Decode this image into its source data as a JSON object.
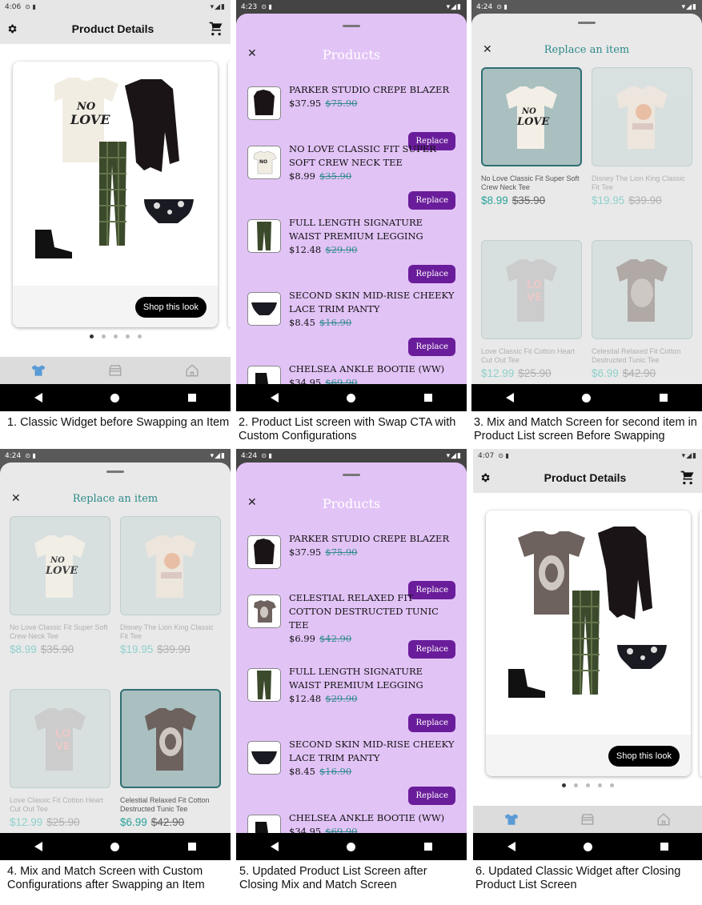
{
  "screens": [
    {
      "time": "4:06",
      "title": "Product Details",
      "shop_label": "Shop this look",
      "caption": "1. Classic Widget before Swapping an Item"
    },
    {
      "time": "4:23",
      "title": "Products",
      "caption": "2. Product List screen with Swap CTA with Custom Configurations",
      "items": [
        {
          "name": "PARKER STUDIO CREPE BLAZER",
          "price": "$37.95",
          "old": "$75.90",
          "cta": "Replace"
        },
        {
          "name": "NO LOVE CLASSIC FIT SUPER SOFT CREW NECK TEE",
          "price": "$8.99",
          "old": "$35.90",
          "cta": "Replace"
        },
        {
          "name": "FULL LENGTH SIGNATURE WAIST PREMIUM LEGGING",
          "price": "$12.48",
          "old": "$29.90",
          "cta": "Replace"
        },
        {
          "name": "SECOND SKIN MID-RISE CHEEKY LACE TRIM PANTY",
          "price": "$8.45",
          "old": "$16.90",
          "cta": "Replace"
        },
        {
          "name": "CHELSEA ANKLE BOOTIE (WW)",
          "price": "$34.95",
          "old": "$69.90",
          "cta": ""
        }
      ]
    },
    {
      "time": "4:24",
      "title": "Replace an item",
      "caption": "3. Mix and Match Screen for second item in Product List screen Before Swapping",
      "tiles": [
        {
          "name": "No Love Classic Fit Super Soft Crew Neck Tee",
          "price": "$8.99",
          "old": "$35.90"
        },
        {
          "name": "Disney The Lion King Classic Fit Tee",
          "price": "$19.95",
          "old": "$39.90"
        },
        {
          "name": "Love Classic Fit Cotton Heart Cut Out Tee",
          "price": "$12.99",
          "old": "$25.90"
        },
        {
          "name": "Celestial Relaxed Fit Cotton Destructed Tunic Tee",
          "price": "$6.99",
          "old": "$42.90"
        }
      ]
    },
    {
      "time": "4:24",
      "title": "Replace an item",
      "caption": "4. Mix and Match Screen with Custom Configurations after Swapping an Item",
      "tiles": [
        {
          "name": "No Love Classic Fit Super Soft Crew Neck Tee",
          "price": "$8.99",
          "old": "$35.90"
        },
        {
          "name": "Disney The Lion King Classic Fit Tee",
          "price": "$19.95",
          "old": "$39.90"
        },
        {
          "name": "Love Classic Fit Cotton Heart Cut Out Tee",
          "price": "$12.99",
          "old": "$25.90"
        },
        {
          "name": "Celestial Relaxed Fit Cotton Destructed Tunic Tee",
          "price": "$6.99",
          "old": "$42.90"
        }
      ]
    },
    {
      "time": "4:24",
      "title": "Products",
      "caption": "5. Updated Product List Screen after Closing Mix and Match Screen",
      "items": [
        {
          "name": "PARKER STUDIO CREPE BLAZER",
          "price": "$37.95",
          "old": "$75.90",
          "cta": "Replace"
        },
        {
          "name": "CELESTIAL RELAXED FIT COTTON DESTRUCTED TUNIC TEE",
          "price": "$6.99",
          "old": "$42.90",
          "cta": "Replace"
        },
        {
          "name": "FULL LENGTH SIGNATURE WAIST PREMIUM LEGGING",
          "price": "$12.48",
          "old": "$29.90",
          "cta": "Replace"
        },
        {
          "name": "SECOND SKIN MID-RISE CHEEKY LACE TRIM PANTY",
          "price": "$8.45",
          "old": "$16.90",
          "cta": "Replace"
        },
        {
          "name": "CHELSEA ANKLE BOOTIE (WW)",
          "price": "$34.95",
          "old": "$69.90",
          "cta": ""
        }
      ]
    },
    {
      "time": "4:07",
      "title": "Product Details",
      "shop_label": "Shop this look",
      "caption": "6. Updated Classic Widget after Closing Product List Screen"
    }
  ]
}
